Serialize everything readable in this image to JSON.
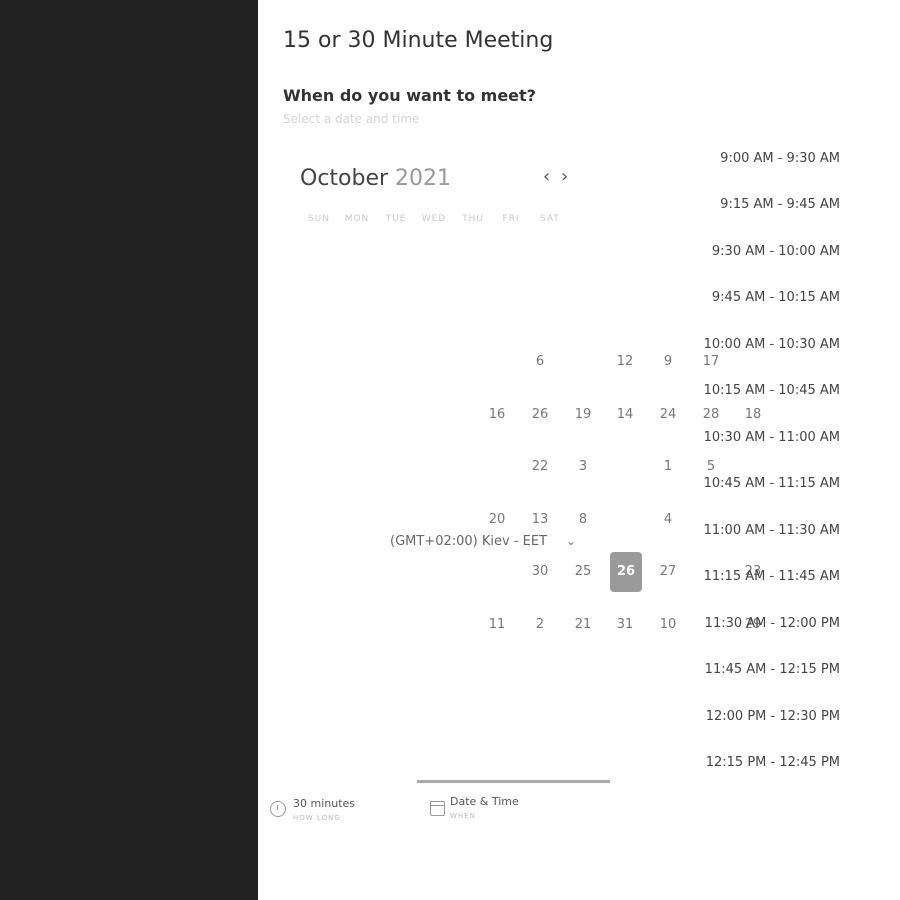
{
  "meeting": {
    "title": "15 or 30 Minute Meeting",
    "question": "When do you want to meet?",
    "hint": "Select a date and time"
  },
  "calendar": {
    "month": "October",
    "year": "2021",
    "prev_icon": "chevron-left-icon",
    "next_icon": "chevron-right-icon",
    "weekdays": [
      "SUN",
      "MON",
      "TUE",
      "WED",
      "THU",
      "FRI",
      "SAT"
    ],
    "days": [
      "6",
      "12",
      "9",
      "17",
      "16",
      "26",
      "19",
      "14",
      "24",
      "28",
      "18",
      "22",
      "3",
      "1",
      "5",
      "20",
      "13",
      "8",
      "4",
      "30",
      "25",
      "26",
      "27",
      "23",
      "11",
      "2",
      "21",
      "31",
      "10",
      "29"
    ],
    "selected_day": "26"
  },
  "timezone": {
    "label": "(GMT+02:00) Kiev - EET",
    "icon": "chevron-down-icon"
  },
  "time_slots": [
    "9:00 AM - 9:30 AM",
    "9:15 AM - 9:45 AM",
    "9:30 AM - 10:00 AM",
    "9:45 AM - 10:15 AM",
    "10:00 AM - 10:30 AM",
    "10:15 AM - 10:45 AM",
    "10:30 AM - 11:00 AM",
    "10:45 AM - 11:15 AM",
    "11:00 AM - 11:30 AM",
    "11:15 AM - 11:45 AM",
    "11:30 AM - 12:00 PM",
    "11:45 AM - 12:15 PM",
    "12:00 PM - 12:30 PM",
    "12:15 PM - 12:45 PM"
  ],
  "footer": {
    "duration": {
      "label": "30 minutes",
      "sub": "HOW LONG",
      "icon": "clock-icon"
    },
    "datetime": {
      "label": "Date & Time",
      "sub": "WHEN",
      "icon": "calendar-icon"
    }
  },
  "colors": {
    "sidebar": "#222222",
    "selected_day": "#9a9a9a"
  }
}
